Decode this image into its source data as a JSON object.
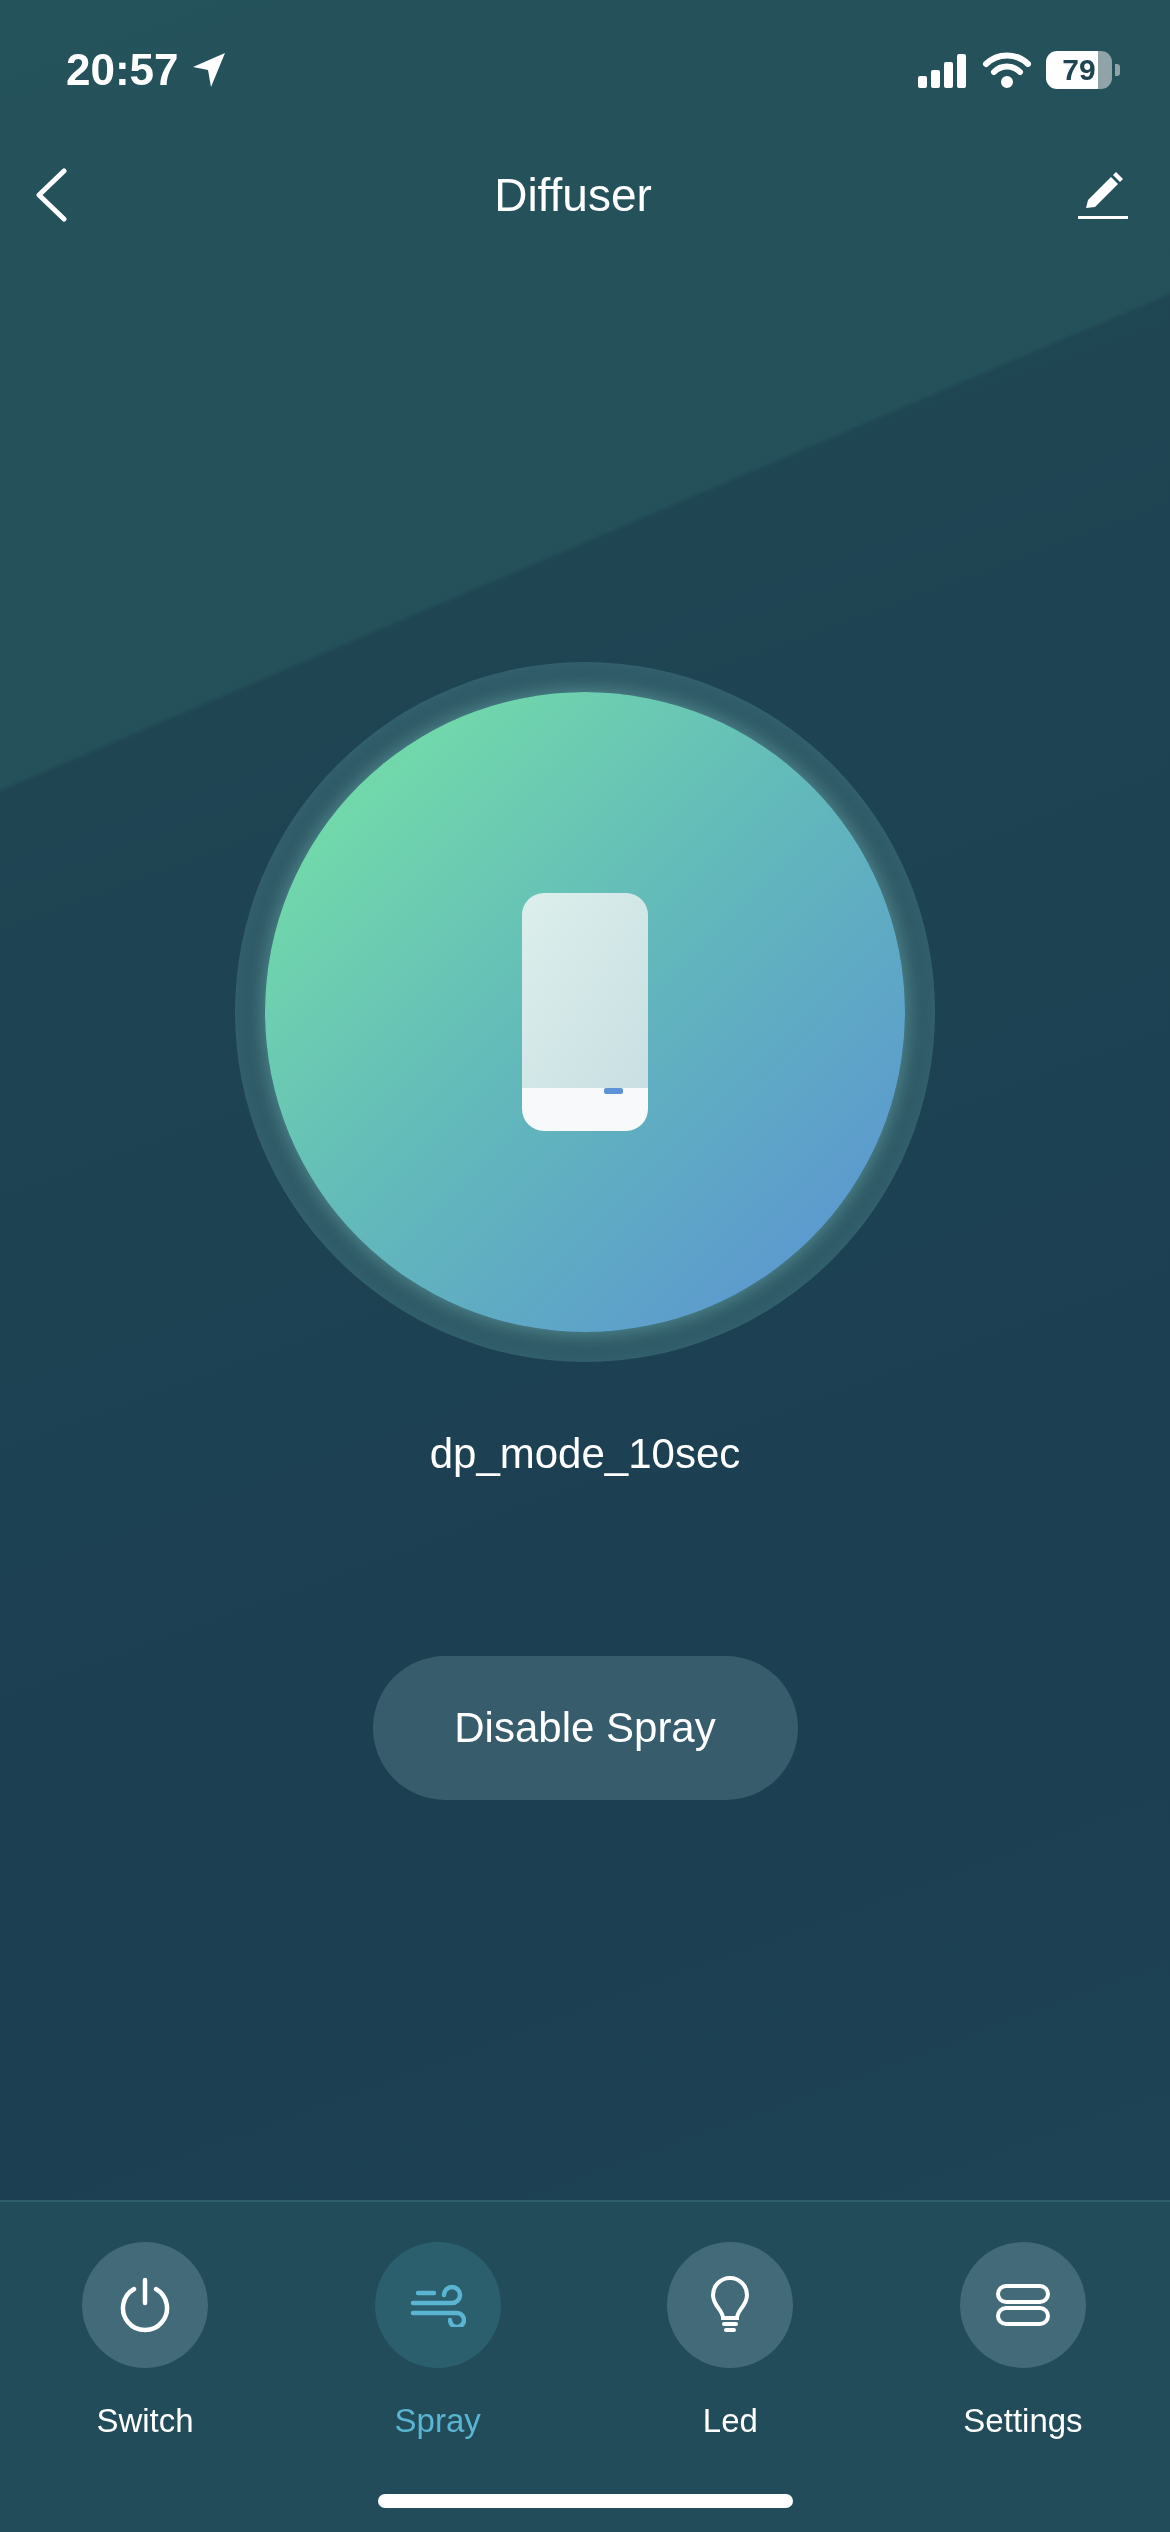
{
  "status_bar": {
    "time": "20:57",
    "battery": "79"
  },
  "nav": {
    "title": "Diffuser"
  },
  "device": {
    "mode": "dp_mode_10sec"
  },
  "action_button": {
    "label": "Disable Spray"
  },
  "tabs": [
    {
      "label": "Switch",
      "kind": "power",
      "selected": false
    },
    {
      "label": "Spray",
      "kind": "wind",
      "selected": true
    },
    {
      "label": "Led",
      "kind": "bulb",
      "selected": false
    },
    {
      "label": "Settings",
      "kind": "toggles",
      "selected": false
    }
  ]
}
